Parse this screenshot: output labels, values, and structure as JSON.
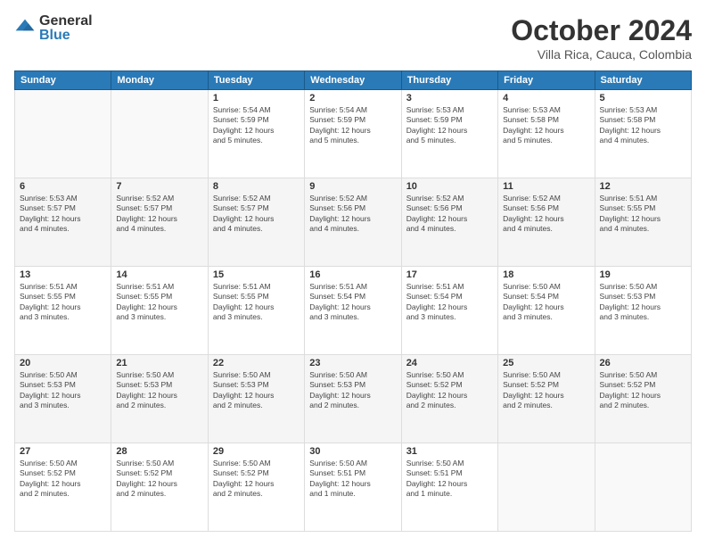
{
  "logo": {
    "general": "General",
    "blue": "Blue"
  },
  "title": "October 2024",
  "location": "Villa Rica, Cauca, Colombia",
  "days_of_week": [
    "Sunday",
    "Monday",
    "Tuesday",
    "Wednesday",
    "Thursday",
    "Friday",
    "Saturday"
  ],
  "weeks": [
    [
      {
        "day": "",
        "info": ""
      },
      {
        "day": "",
        "info": ""
      },
      {
        "day": "1",
        "info": "Sunrise: 5:54 AM\nSunset: 5:59 PM\nDaylight: 12 hours\nand 5 minutes."
      },
      {
        "day": "2",
        "info": "Sunrise: 5:54 AM\nSunset: 5:59 PM\nDaylight: 12 hours\nand 5 minutes."
      },
      {
        "day": "3",
        "info": "Sunrise: 5:53 AM\nSunset: 5:59 PM\nDaylight: 12 hours\nand 5 minutes."
      },
      {
        "day": "4",
        "info": "Sunrise: 5:53 AM\nSunset: 5:58 PM\nDaylight: 12 hours\nand 5 minutes."
      },
      {
        "day": "5",
        "info": "Sunrise: 5:53 AM\nSunset: 5:58 PM\nDaylight: 12 hours\nand 4 minutes."
      }
    ],
    [
      {
        "day": "6",
        "info": "Sunrise: 5:53 AM\nSunset: 5:57 PM\nDaylight: 12 hours\nand 4 minutes."
      },
      {
        "day": "7",
        "info": "Sunrise: 5:52 AM\nSunset: 5:57 PM\nDaylight: 12 hours\nand 4 minutes."
      },
      {
        "day": "8",
        "info": "Sunrise: 5:52 AM\nSunset: 5:57 PM\nDaylight: 12 hours\nand 4 minutes."
      },
      {
        "day": "9",
        "info": "Sunrise: 5:52 AM\nSunset: 5:56 PM\nDaylight: 12 hours\nand 4 minutes."
      },
      {
        "day": "10",
        "info": "Sunrise: 5:52 AM\nSunset: 5:56 PM\nDaylight: 12 hours\nand 4 minutes."
      },
      {
        "day": "11",
        "info": "Sunrise: 5:52 AM\nSunset: 5:56 PM\nDaylight: 12 hours\nand 4 minutes."
      },
      {
        "day": "12",
        "info": "Sunrise: 5:51 AM\nSunset: 5:55 PM\nDaylight: 12 hours\nand 4 minutes."
      }
    ],
    [
      {
        "day": "13",
        "info": "Sunrise: 5:51 AM\nSunset: 5:55 PM\nDaylight: 12 hours\nand 3 minutes."
      },
      {
        "day": "14",
        "info": "Sunrise: 5:51 AM\nSunset: 5:55 PM\nDaylight: 12 hours\nand 3 minutes."
      },
      {
        "day": "15",
        "info": "Sunrise: 5:51 AM\nSunset: 5:55 PM\nDaylight: 12 hours\nand 3 minutes."
      },
      {
        "day": "16",
        "info": "Sunrise: 5:51 AM\nSunset: 5:54 PM\nDaylight: 12 hours\nand 3 minutes."
      },
      {
        "day": "17",
        "info": "Sunrise: 5:51 AM\nSunset: 5:54 PM\nDaylight: 12 hours\nand 3 minutes."
      },
      {
        "day": "18",
        "info": "Sunrise: 5:50 AM\nSunset: 5:54 PM\nDaylight: 12 hours\nand 3 minutes."
      },
      {
        "day": "19",
        "info": "Sunrise: 5:50 AM\nSunset: 5:53 PM\nDaylight: 12 hours\nand 3 minutes."
      }
    ],
    [
      {
        "day": "20",
        "info": "Sunrise: 5:50 AM\nSunset: 5:53 PM\nDaylight: 12 hours\nand 3 minutes."
      },
      {
        "day": "21",
        "info": "Sunrise: 5:50 AM\nSunset: 5:53 PM\nDaylight: 12 hours\nand 2 minutes."
      },
      {
        "day": "22",
        "info": "Sunrise: 5:50 AM\nSunset: 5:53 PM\nDaylight: 12 hours\nand 2 minutes."
      },
      {
        "day": "23",
        "info": "Sunrise: 5:50 AM\nSunset: 5:53 PM\nDaylight: 12 hours\nand 2 minutes."
      },
      {
        "day": "24",
        "info": "Sunrise: 5:50 AM\nSunset: 5:52 PM\nDaylight: 12 hours\nand 2 minutes."
      },
      {
        "day": "25",
        "info": "Sunrise: 5:50 AM\nSunset: 5:52 PM\nDaylight: 12 hours\nand 2 minutes."
      },
      {
        "day": "26",
        "info": "Sunrise: 5:50 AM\nSunset: 5:52 PM\nDaylight: 12 hours\nand 2 minutes."
      }
    ],
    [
      {
        "day": "27",
        "info": "Sunrise: 5:50 AM\nSunset: 5:52 PM\nDaylight: 12 hours\nand 2 minutes."
      },
      {
        "day": "28",
        "info": "Sunrise: 5:50 AM\nSunset: 5:52 PM\nDaylight: 12 hours\nand 2 minutes."
      },
      {
        "day": "29",
        "info": "Sunrise: 5:50 AM\nSunset: 5:52 PM\nDaylight: 12 hours\nand 2 minutes."
      },
      {
        "day": "30",
        "info": "Sunrise: 5:50 AM\nSunset: 5:51 PM\nDaylight: 12 hours\nand 1 minute."
      },
      {
        "day": "31",
        "info": "Sunrise: 5:50 AM\nSunset: 5:51 PM\nDaylight: 12 hours\nand 1 minute."
      },
      {
        "day": "",
        "info": ""
      },
      {
        "day": "",
        "info": ""
      }
    ]
  ]
}
